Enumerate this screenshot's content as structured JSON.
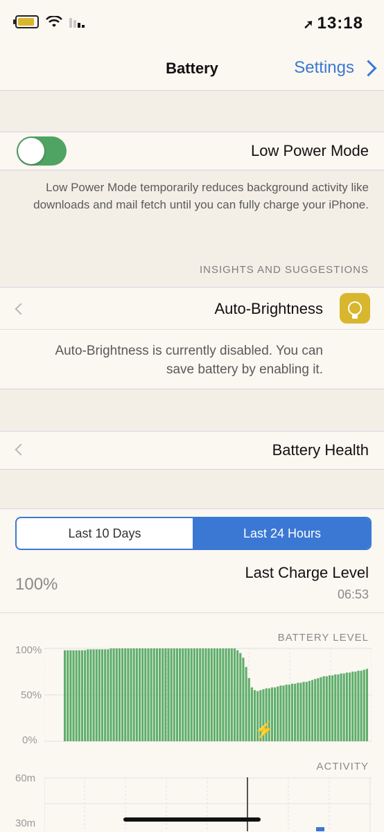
{
  "status": {
    "time": "13:18",
    "location_icon": "location-arrow-icon"
  },
  "nav": {
    "back_label": "Settings",
    "title": "Battery"
  },
  "low_power": {
    "label": "Low Power Mode",
    "enabled": true,
    "footnote": "Low Power Mode temporarily reduces background activity like downloads and mail fetch until you can fully charge your iPhone."
  },
  "insights": {
    "header": "INSIGHTS AND SUGGESTIONS",
    "item_label": "Auto-Brightness",
    "item_desc": "Auto-Brightness is currently disabled. You can save battery by enabling it."
  },
  "battery_health": {
    "label": "Battery Health"
  },
  "segments": {
    "left_label": "Last 24 Hours",
    "right_label": "Last 10 Days",
    "selected": "Last 24 Hours"
  },
  "last_charge": {
    "title": "Last Charge Level",
    "time": "06:53",
    "level": "100%"
  },
  "battery_chart": {
    "label": "BATTERY LEVEL",
    "y_top": "100%",
    "y_mid": "50%",
    "y_bot": "0%"
  },
  "activity_chart": {
    "label": "ACTIVITY",
    "y_top": "60m",
    "y_bot": "30m"
  },
  "colors": {
    "accent": "#3b78d4",
    "toggle_on": "#4fa464",
    "bar": "#5fae6c",
    "bulb": "#d8b62e"
  },
  "chart_data": {
    "type": "bar",
    "title": "",
    "ylabel": "",
    "ylim": [
      0,
      100
    ],
    "y_ticks": [
      "0%",
      "50%",
      "100%"
    ],
    "values": [
      98,
      98,
      98,
      98,
      98,
      98,
      98,
      98,
      99,
      99,
      99,
      99,
      99,
      99,
      99,
      99,
      100,
      100,
      100,
      100,
      100,
      100,
      100,
      100,
      100,
      100,
      100,
      100,
      100,
      100,
      100,
      100,
      100,
      100,
      100,
      100,
      100,
      100,
      100,
      100,
      100,
      100,
      100,
      100,
      100,
      100,
      100,
      100,
      100,
      100,
      100,
      100,
      100,
      100,
      100,
      100,
      100,
      100,
      100,
      100,
      98,
      95,
      90,
      80,
      68,
      58,
      55,
      54,
      55,
      56,
      57,
      57,
      58,
      58,
      59,
      60,
      60,
      61,
      61,
      62,
      62,
      63,
      63,
      64,
      64,
      65,
      66,
      67,
      68,
      69,
      70,
      70,
      71,
      71,
      72,
      72,
      73,
      73,
      74,
      74,
      75,
      75,
      76,
      76,
      77,
      78
    ]
  }
}
